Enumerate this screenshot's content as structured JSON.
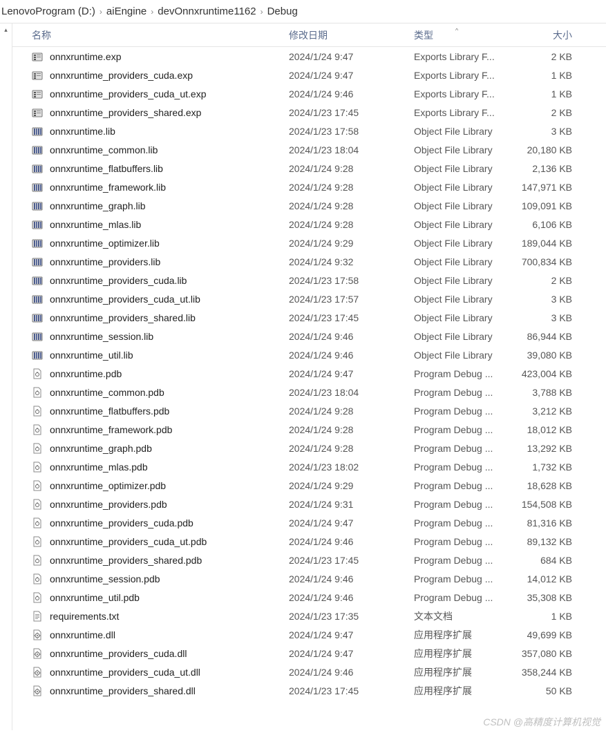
{
  "breadcrumb": {
    "parts": [
      "LenovoProgram (D:)",
      "aiEngine",
      "devOnnxruntime1162",
      "Debug"
    ]
  },
  "headers": {
    "name": "名称",
    "date": "修改日期",
    "type": "类型",
    "size": "大小"
  },
  "sort_indicator": "^",
  "files": [
    {
      "name": "onnxruntime.exp",
      "date": "2024/1/24 9:47",
      "type": "Exports Library F...",
      "size": "2 KB",
      "icon": "exp"
    },
    {
      "name": "onnxruntime_providers_cuda.exp",
      "date": "2024/1/24 9:47",
      "type": "Exports Library F...",
      "size": "1 KB",
      "icon": "exp"
    },
    {
      "name": "onnxruntime_providers_cuda_ut.exp",
      "date": "2024/1/24 9:46",
      "type": "Exports Library F...",
      "size": "1 KB",
      "icon": "exp"
    },
    {
      "name": "onnxruntime_providers_shared.exp",
      "date": "2024/1/23 17:45",
      "type": "Exports Library F...",
      "size": "2 KB",
      "icon": "exp"
    },
    {
      "name": "onnxruntime.lib",
      "date": "2024/1/23 17:58",
      "type": "Object File Library",
      "size": "3 KB",
      "icon": "lib"
    },
    {
      "name": "onnxruntime_common.lib",
      "date": "2024/1/23 18:04",
      "type": "Object File Library",
      "size": "20,180 KB",
      "icon": "lib"
    },
    {
      "name": "onnxruntime_flatbuffers.lib",
      "date": "2024/1/24 9:28",
      "type": "Object File Library",
      "size": "2,136 KB",
      "icon": "lib"
    },
    {
      "name": "onnxruntime_framework.lib",
      "date": "2024/1/24 9:28",
      "type": "Object File Library",
      "size": "147,971 KB",
      "icon": "lib"
    },
    {
      "name": "onnxruntime_graph.lib",
      "date": "2024/1/24 9:28",
      "type": "Object File Library",
      "size": "109,091 KB",
      "icon": "lib"
    },
    {
      "name": "onnxruntime_mlas.lib",
      "date": "2024/1/24 9:28",
      "type": "Object File Library",
      "size": "6,106 KB",
      "icon": "lib"
    },
    {
      "name": "onnxruntime_optimizer.lib",
      "date": "2024/1/24 9:29",
      "type": "Object File Library",
      "size": "189,044 KB",
      "icon": "lib"
    },
    {
      "name": "onnxruntime_providers.lib",
      "date": "2024/1/24 9:32",
      "type": "Object File Library",
      "size": "700,834 KB",
      "icon": "lib"
    },
    {
      "name": "onnxruntime_providers_cuda.lib",
      "date": "2024/1/23 17:58",
      "type": "Object File Library",
      "size": "2 KB",
      "icon": "lib"
    },
    {
      "name": "onnxruntime_providers_cuda_ut.lib",
      "date": "2024/1/23 17:57",
      "type": "Object File Library",
      "size": "3 KB",
      "icon": "lib"
    },
    {
      "name": "onnxruntime_providers_shared.lib",
      "date": "2024/1/23 17:45",
      "type": "Object File Library",
      "size": "3 KB",
      "icon": "lib"
    },
    {
      "name": "onnxruntime_session.lib",
      "date": "2024/1/24 9:46",
      "type": "Object File Library",
      "size": "86,944 KB",
      "icon": "lib"
    },
    {
      "name": "onnxruntime_util.lib",
      "date": "2024/1/24 9:46",
      "type": "Object File Library",
      "size": "39,080 KB",
      "icon": "lib"
    },
    {
      "name": "onnxruntime.pdb",
      "date": "2024/1/24 9:47",
      "type": "Program Debug ...",
      "size": "423,004 KB",
      "icon": "pdb"
    },
    {
      "name": "onnxruntime_common.pdb",
      "date": "2024/1/23 18:04",
      "type": "Program Debug ...",
      "size": "3,788 KB",
      "icon": "pdb"
    },
    {
      "name": "onnxruntime_flatbuffers.pdb",
      "date": "2024/1/24 9:28",
      "type": "Program Debug ...",
      "size": "3,212 KB",
      "icon": "pdb"
    },
    {
      "name": "onnxruntime_framework.pdb",
      "date": "2024/1/24 9:28",
      "type": "Program Debug ...",
      "size": "18,012 KB",
      "icon": "pdb"
    },
    {
      "name": "onnxruntime_graph.pdb",
      "date": "2024/1/24 9:28",
      "type": "Program Debug ...",
      "size": "13,292 KB",
      "icon": "pdb"
    },
    {
      "name": "onnxruntime_mlas.pdb",
      "date": "2024/1/23 18:02",
      "type": "Program Debug ...",
      "size": "1,732 KB",
      "icon": "pdb"
    },
    {
      "name": "onnxruntime_optimizer.pdb",
      "date": "2024/1/24 9:29",
      "type": "Program Debug ...",
      "size": "18,628 KB",
      "icon": "pdb"
    },
    {
      "name": "onnxruntime_providers.pdb",
      "date": "2024/1/24 9:31",
      "type": "Program Debug ...",
      "size": "154,508 KB",
      "icon": "pdb"
    },
    {
      "name": "onnxruntime_providers_cuda.pdb",
      "date": "2024/1/24 9:47",
      "type": "Program Debug ...",
      "size": "81,316 KB",
      "icon": "pdb"
    },
    {
      "name": "onnxruntime_providers_cuda_ut.pdb",
      "date": "2024/1/24 9:46",
      "type": "Program Debug ...",
      "size": "89,132 KB",
      "icon": "pdb"
    },
    {
      "name": "onnxruntime_providers_shared.pdb",
      "date": "2024/1/23 17:45",
      "type": "Program Debug ...",
      "size": "684 KB",
      "icon": "pdb"
    },
    {
      "name": "onnxruntime_session.pdb",
      "date": "2024/1/24 9:46",
      "type": "Program Debug ...",
      "size": "14,012 KB",
      "icon": "pdb"
    },
    {
      "name": "onnxruntime_util.pdb",
      "date": "2024/1/24 9:46",
      "type": "Program Debug ...",
      "size": "35,308 KB",
      "icon": "pdb"
    },
    {
      "name": "requirements.txt",
      "date": "2024/1/23 17:35",
      "type": "文本文档",
      "size": "1 KB",
      "icon": "txt"
    },
    {
      "name": "onnxruntime.dll",
      "date": "2024/1/24 9:47",
      "type": "应用程序扩展",
      "size": "49,699 KB",
      "icon": "dll"
    },
    {
      "name": "onnxruntime_providers_cuda.dll",
      "date": "2024/1/24 9:47",
      "type": "应用程序扩展",
      "size": "357,080 KB",
      "icon": "dll"
    },
    {
      "name": "onnxruntime_providers_cuda_ut.dll",
      "date": "2024/1/24 9:46",
      "type": "应用程序扩展",
      "size": "358,244 KB",
      "icon": "dll"
    },
    {
      "name": "onnxruntime_providers_shared.dll",
      "date": "2024/1/23 17:45",
      "type": "应用程序扩展",
      "size": "50 KB",
      "icon": "dll"
    }
  ],
  "watermark": "CSDN @高精度计算机视觉"
}
